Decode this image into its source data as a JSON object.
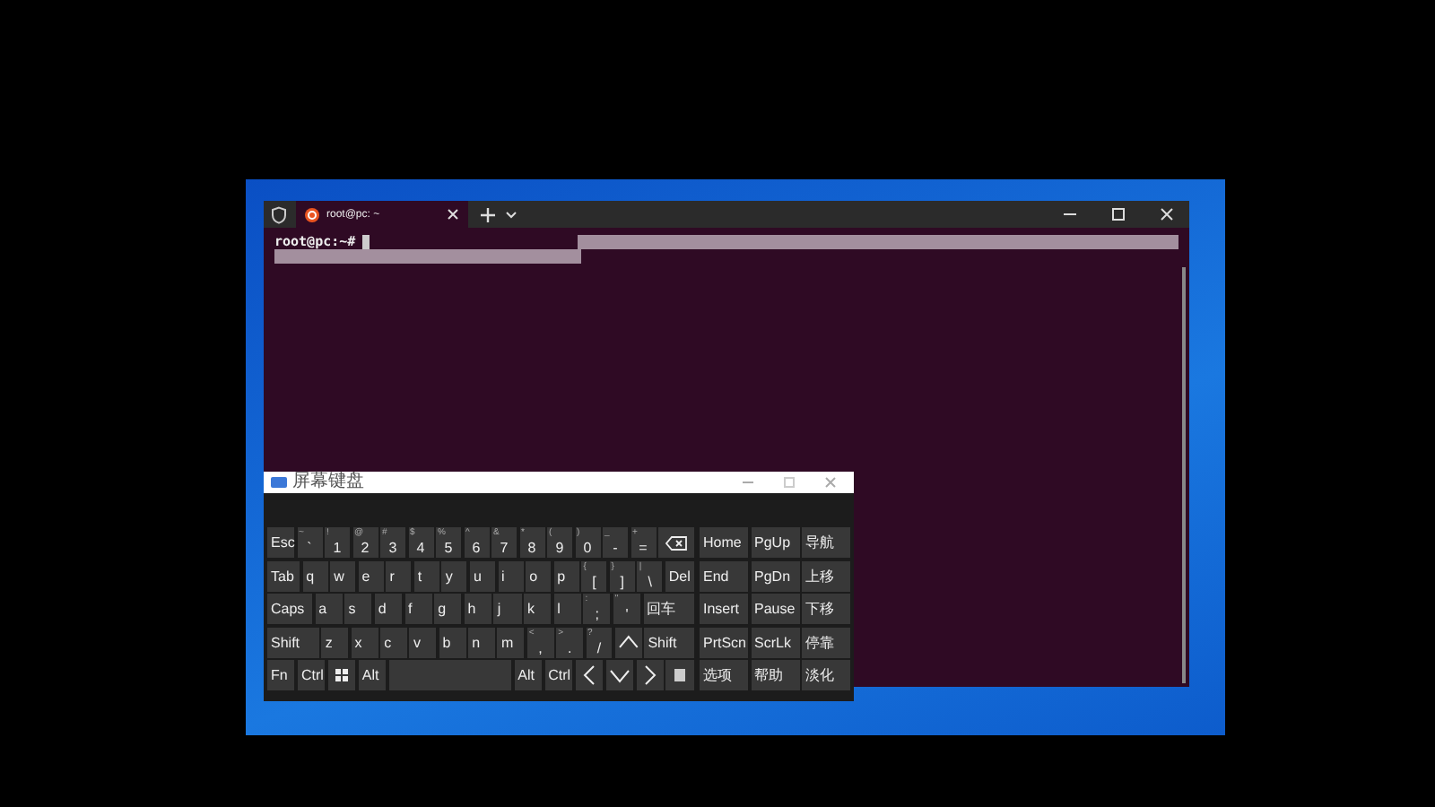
{
  "terminal": {
    "tab_title": "root@pc: ~",
    "prompt": "root@pc:~#"
  },
  "keyboard": {
    "title": "屏幕键盘",
    "rows": [
      [
        {
          "kind": "text",
          "label": "Esc"
        },
        {
          "kind": "text",
          "label": "`",
          "shift": "~"
        },
        {
          "kind": "text",
          "label": "1",
          "shift": "!"
        },
        {
          "kind": "text",
          "label": "2",
          "shift": "@"
        },
        {
          "kind": "text",
          "label": "3",
          "shift": "#"
        },
        {
          "kind": "text",
          "label": "4",
          "shift": "$"
        },
        {
          "kind": "text",
          "label": "5",
          "shift": "%"
        },
        {
          "kind": "text",
          "label": "6",
          "shift": "^"
        },
        {
          "kind": "text",
          "label": "7",
          "shift": "&"
        },
        {
          "kind": "text",
          "label": "8",
          "shift": "*"
        },
        {
          "kind": "text",
          "label": "9",
          "shift": "("
        },
        {
          "kind": "text",
          "label": "0",
          "shift": ")"
        },
        {
          "kind": "text",
          "label": "-",
          "shift": "_"
        },
        {
          "kind": "text",
          "label": "=",
          "shift": "+"
        },
        {
          "kind": "backspace"
        }
      ],
      [
        {
          "kind": "text",
          "label": "Tab"
        },
        {
          "kind": "text",
          "label": "q"
        },
        {
          "kind": "text",
          "label": "w"
        },
        {
          "kind": "text",
          "label": "e"
        },
        {
          "kind": "text",
          "label": "r"
        },
        {
          "kind": "text",
          "label": "t"
        },
        {
          "kind": "text",
          "label": "y"
        },
        {
          "kind": "text",
          "label": "u"
        },
        {
          "kind": "text",
          "label": "i"
        },
        {
          "kind": "text",
          "label": "o"
        },
        {
          "kind": "text",
          "label": "p"
        },
        {
          "kind": "text",
          "label": "[",
          "shift": "{"
        },
        {
          "kind": "text",
          "label": "]",
          "shift": "}"
        },
        {
          "kind": "text",
          "label": "\\",
          "shift": "|"
        },
        {
          "kind": "text",
          "label": "Del"
        }
      ],
      [
        {
          "kind": "text",
          "label": "Caps"
        },
        {
          "kind": "text",
          "label": "a"
        },
        {
          "kind": "text",
          "label": "s"
        },
        {
          "kind": "text",
          "label": "d"
        },
        {
          "kind": "text",
          "label": "f"
        },
        {
          "kind": "text",
          "label": "g"
        },
        {
          "kind": "text",
          "label": "h"
        },
        {
          "kind": "text",
          "label": "j"
        },
        {
          "kind": "text",
          "label": "k"
        },
        {
          "kind": "text",
          "label": "l"
        },
        {
          "kind": "text",
          "label": ";",
          "shift": ":"
        },
        {
          "kind": "text",
          "label": "'",
          "shift": "\""
        },
        {
          "kind": "text",
          "label": "回车"
        }
      ],
      [
        {
          "kind": "text",
          "label": "Shift"
        },
        {
          "kind": "text",
          "label": "z"
        },
        {
          "kind": "text",
          "label": "x"
        },
        {
          "kind": "text",
          "label": "c"
        },
        {
          "kind": "text",
          "label": "v"
        },
        {
          "kind": "text",
          "label": "b"
        },
        {
          "kind": "text",
          "label": "n"
        },
        {
          "kind": "text",
          "label": "m"
        },
        {
          "kind": "text",
          "label": ",",
          "shift": "<"
        },
        {
          "kind": "text",
          "label": ".",
          "shift": ">"
        },
        {
          "kind": "text",
          "label": "/",
          "shift": "?"
        },
        {
          "kind": "up"
        },
        {
          "kind": "text",
          "label": "Shift"
        }
      ],
      [
        {
          "kind": "text",
          "label": "Fn"
        },
        {
          "kind": "text",
          "label": "Ctrl"
        },
        {
          "kind": "windows"
        },
        {
          "kind": "text",
          "label": "Alt"
        },
        {
          "kind": "space"
        },
        {
          "kind": "text",
          "label": "Alt"
        },
        {
          "kind": "text",
          "label": "Ctrl"
        },
        {
          "kind": "left"
        },
        {
          "kind": "down"
        },
        {
          "kind": "right"
        },
        {
          "kind": "menu"
        }
      ]
    ],
    "nav": [
      [
        "Home",
        "PgUp",
        "导航"
      ],
      [
        "End",
        "PgDn",
        "上移"
      ],
      [
        "Insert",
        "Pause",
        "下移"
      ],
      [
        "PrtScn",
        "ScrLk",
        "停靠"
      ],
      [
        "选项",
        "帮助",
        "淡化"
      ]
    ]
  }
}
